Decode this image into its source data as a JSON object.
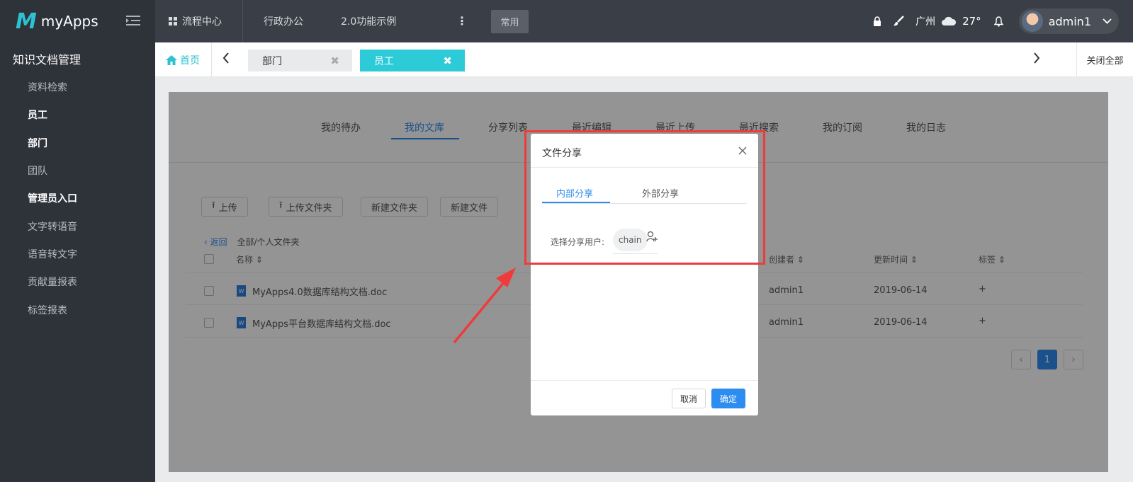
{
  "topbar": {
    "logo_mark": "M",
    "logo_text": "myApps",
    "menu_icon": "menu-fold-icon",
    "items": [
      {
        "label": "流程中心",
        "icon": "grid-icon"
      },
      {
        "label": "行政办公"
      },
      {
        "label": "2.0功能示例"
      }
    ],
    "more": "⋮",
    "common_label": "常用",
    "city": "广州",
    "temperature": "27°",
    "user": "admin1",
    "icons": [
      "lock-icon",
      "brush-icon",
      "cloud-icon",
      "bell-icon",
      "chevron-down-icon"
    ]
  },
  "sidebar": {
    "title": "知识文档管理",
    "items": [
      {
        "label": "资料检索"
      },
      {
        "label": "员工"
      },
      {
        "label": "部门"
      },
      {
        "label": "团队"
      },
      {
        "label": "管理员入口"
      },
      {
        "label": "文字转语音"
      },
      {
        "label": "语音转文字"
      },
      {
        "label": "贡献量报表"
      },
      {
        "label": "标签报表"
      }
    ]
  },
  "tabs": {
    "home": "首页",
    "open": [
      {
        "label": "部门",
        "active": false
      },
      {
        "label": "员工",
        "active": true
      }
    ],
    "close_all": "关闭全部"
  },
  "subnav": {
    "tabs": [
      "我的待办",
      "我的文库",
      "分享列表",
      "最近编辑",
      "最近上传",
      "最近搜索",
      "我的订阅",
      "我的日志"
    ],
    "active": "我的文库"
  },
  "toolbar": {
    "upload": "上传",
    "upload_folder": "上传文件夹",
    "new_folder": "新建文件夹",
    "new_file": "新建文件"
  },
  "breadcrumb": {
    "back": "返回",
    "path": "全部/个人文件夹"
  },
  "table": {
    "columns": [
      "名称",
      "创建者",
      "更新时间",
      "标签"
    ],
    "rows": [
      {
        "name": "MyApps4.0数据库结构文档.doc",
        "creator": "admin1",
        "updated": "2019-06-14",
        "tag": "+"
      },
      {
        "name": "MyApps平台数据库结构文档.doc",
        "creator": "admin1",
        "updated": "2019-06-14",
        "tag": "+"
      }
    ]
  },
  "pagination": {
    "current": "1"
  },
  "dialog": {
    "title": "文件分享",
    "tabs": [
      "内部分享",
      "外部分享"
    ],
    "active_tab": "内部分享",
    "select_label": "选择分享用户:",
    "selected_user": "chain",
    "cancel": "取消",
    "confirm": "确定"
  },
  "colors": {
    "accent": "#2dc2d1",
    "primary": "#2d8cf0",
    "highlight": "#ef3b3b",
    "sidebar_bg": "#2e3239",
    "topbar_bg": "#3a3f47"
  }
}
